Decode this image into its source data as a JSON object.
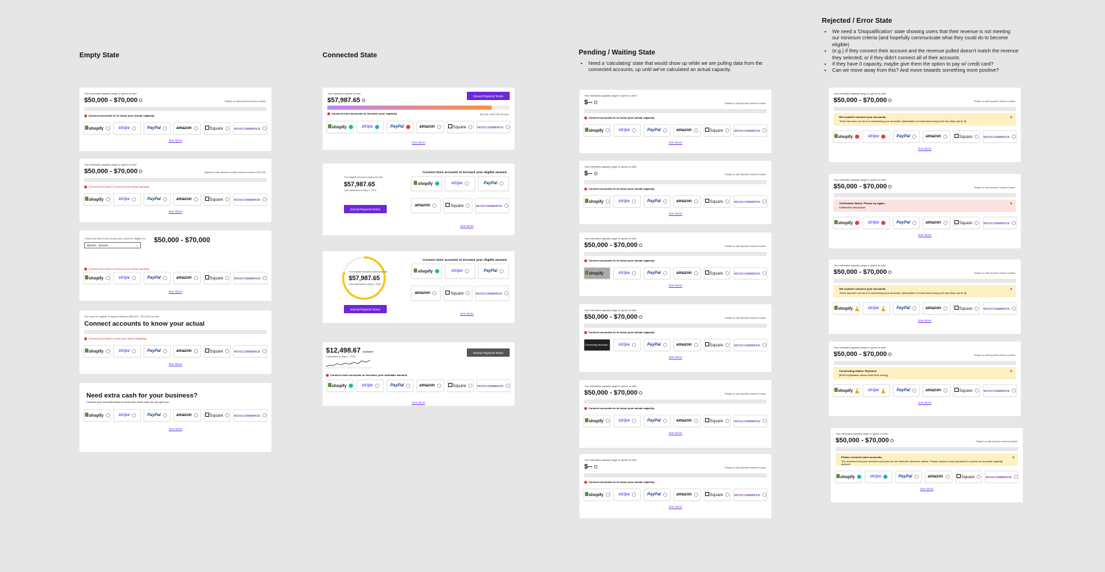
{
  "columns": {
    "empty": {
      "title": "Empty State"
    },
    "connected": {
      "title": "Connected State"
    },
    "pending": {
      "title": "Pending / Waiting State",
      "notes": [
        "Need a 'calculating' state that would show up while we are pulling data from the connected accounts, up until we've calculated an actual capacity."
      ]
    },
    "rejected": {
      "title": "Rejected / Error State",
      "notes": [
        "We need a 'Disqualification' state showing users that their revenue is not meeting our minimum criteria (and hopefully communicate what they could do to become eligible)",
        "(e.g.) if they connect their account and the revenue pulled doesn't match the revenue they selected; or if they didn't connect all of their accounts",
        "If they have 0 capacity, maybe give them the option to pay w/ credit card?",
        "Can we move away from this? And move towards something more positive?"
      ]
    }
  },
  "common": {
    "caption": "Your estimated capacity range to spend on tofu*",
    "range": "$50,000 - $70,000",
    "pending_amt": "$--",
    "based_note": "*Based on self-reported revenue bucket",
    "based_note_monthly": "*Based on self-reported monthly revenue bucket of $10-20k",
    "connect_msg": "Connect accounts to to know your actual capacity.",
    "connect_eligibility": "Connect accounts to know your actual eligibility.",
    "see_more": "See More",
    "logos": [
      "shopify",
      "stripe",
      "PayPal",
      "amazon",
      "Square",
      "WOOCOMMERCE"
    ]
  },
  "empty": {
    "check_label": "Check out how much money you could be eligible for",
    "select_value": "$50000 - $25000",
    "eligible_caption": "You may be eligible to spend between $50,000 - $70,000 on tofu",
    "connect_heading": "Connect accounts to know your actual",
    "cash_heading": "Need extra cash for your business?",
    "cash_sub": "Connect your accounts below to know how much cash we can give you."
  },
  "connected": {
    "cap_caption": "Your capacity to spend on tofu",
    "amount": "$57,987.65",
    "extend_btn": "Extend Payment Terms",
    "increase_msg": "Connect more accounts to increase your capacity.",
    "progress_note": "$20,000 of $57,987.65 used",
    "eligible_caption": "Your eligible amount to spend on tofu",
    "calc_date": "Last calculated on May 1, 2022",
    "increase_eligible": "Connect more accounts to increase your eligible amount.",
    "avail_amount": "$12,498.67",
    "avail_label": "available",
    "calc_on": "Calculated on May 1, 2022",
    "increase_avail": "Connect more accounts to increase your available amount.",
    "progress": 0.9
  },
  "pending": {
    "connecting": "Connecting accounts..."
  },
  "rejected": {
    "a1_title": "We couldn't connect your accounts.",
    "a1_desc": "There has been an error in connecting your accounts. [description of what went wrong and how they can fix it]",
    "a2_title": "Verification failed. Please try again.",
    "a2_desc": "Notification description",
    "a4_title": "Connecting status: Rejected",
    "a4_desc": "[Brief explanation about what went wrong]",
    "a5_title": "Please connect more accounts.",
    "a5_desc": "The revenue from your selected accounts do not meet the minimum criteria. Please connect more accounts to receive an accurate capacity amount."
  }
}
